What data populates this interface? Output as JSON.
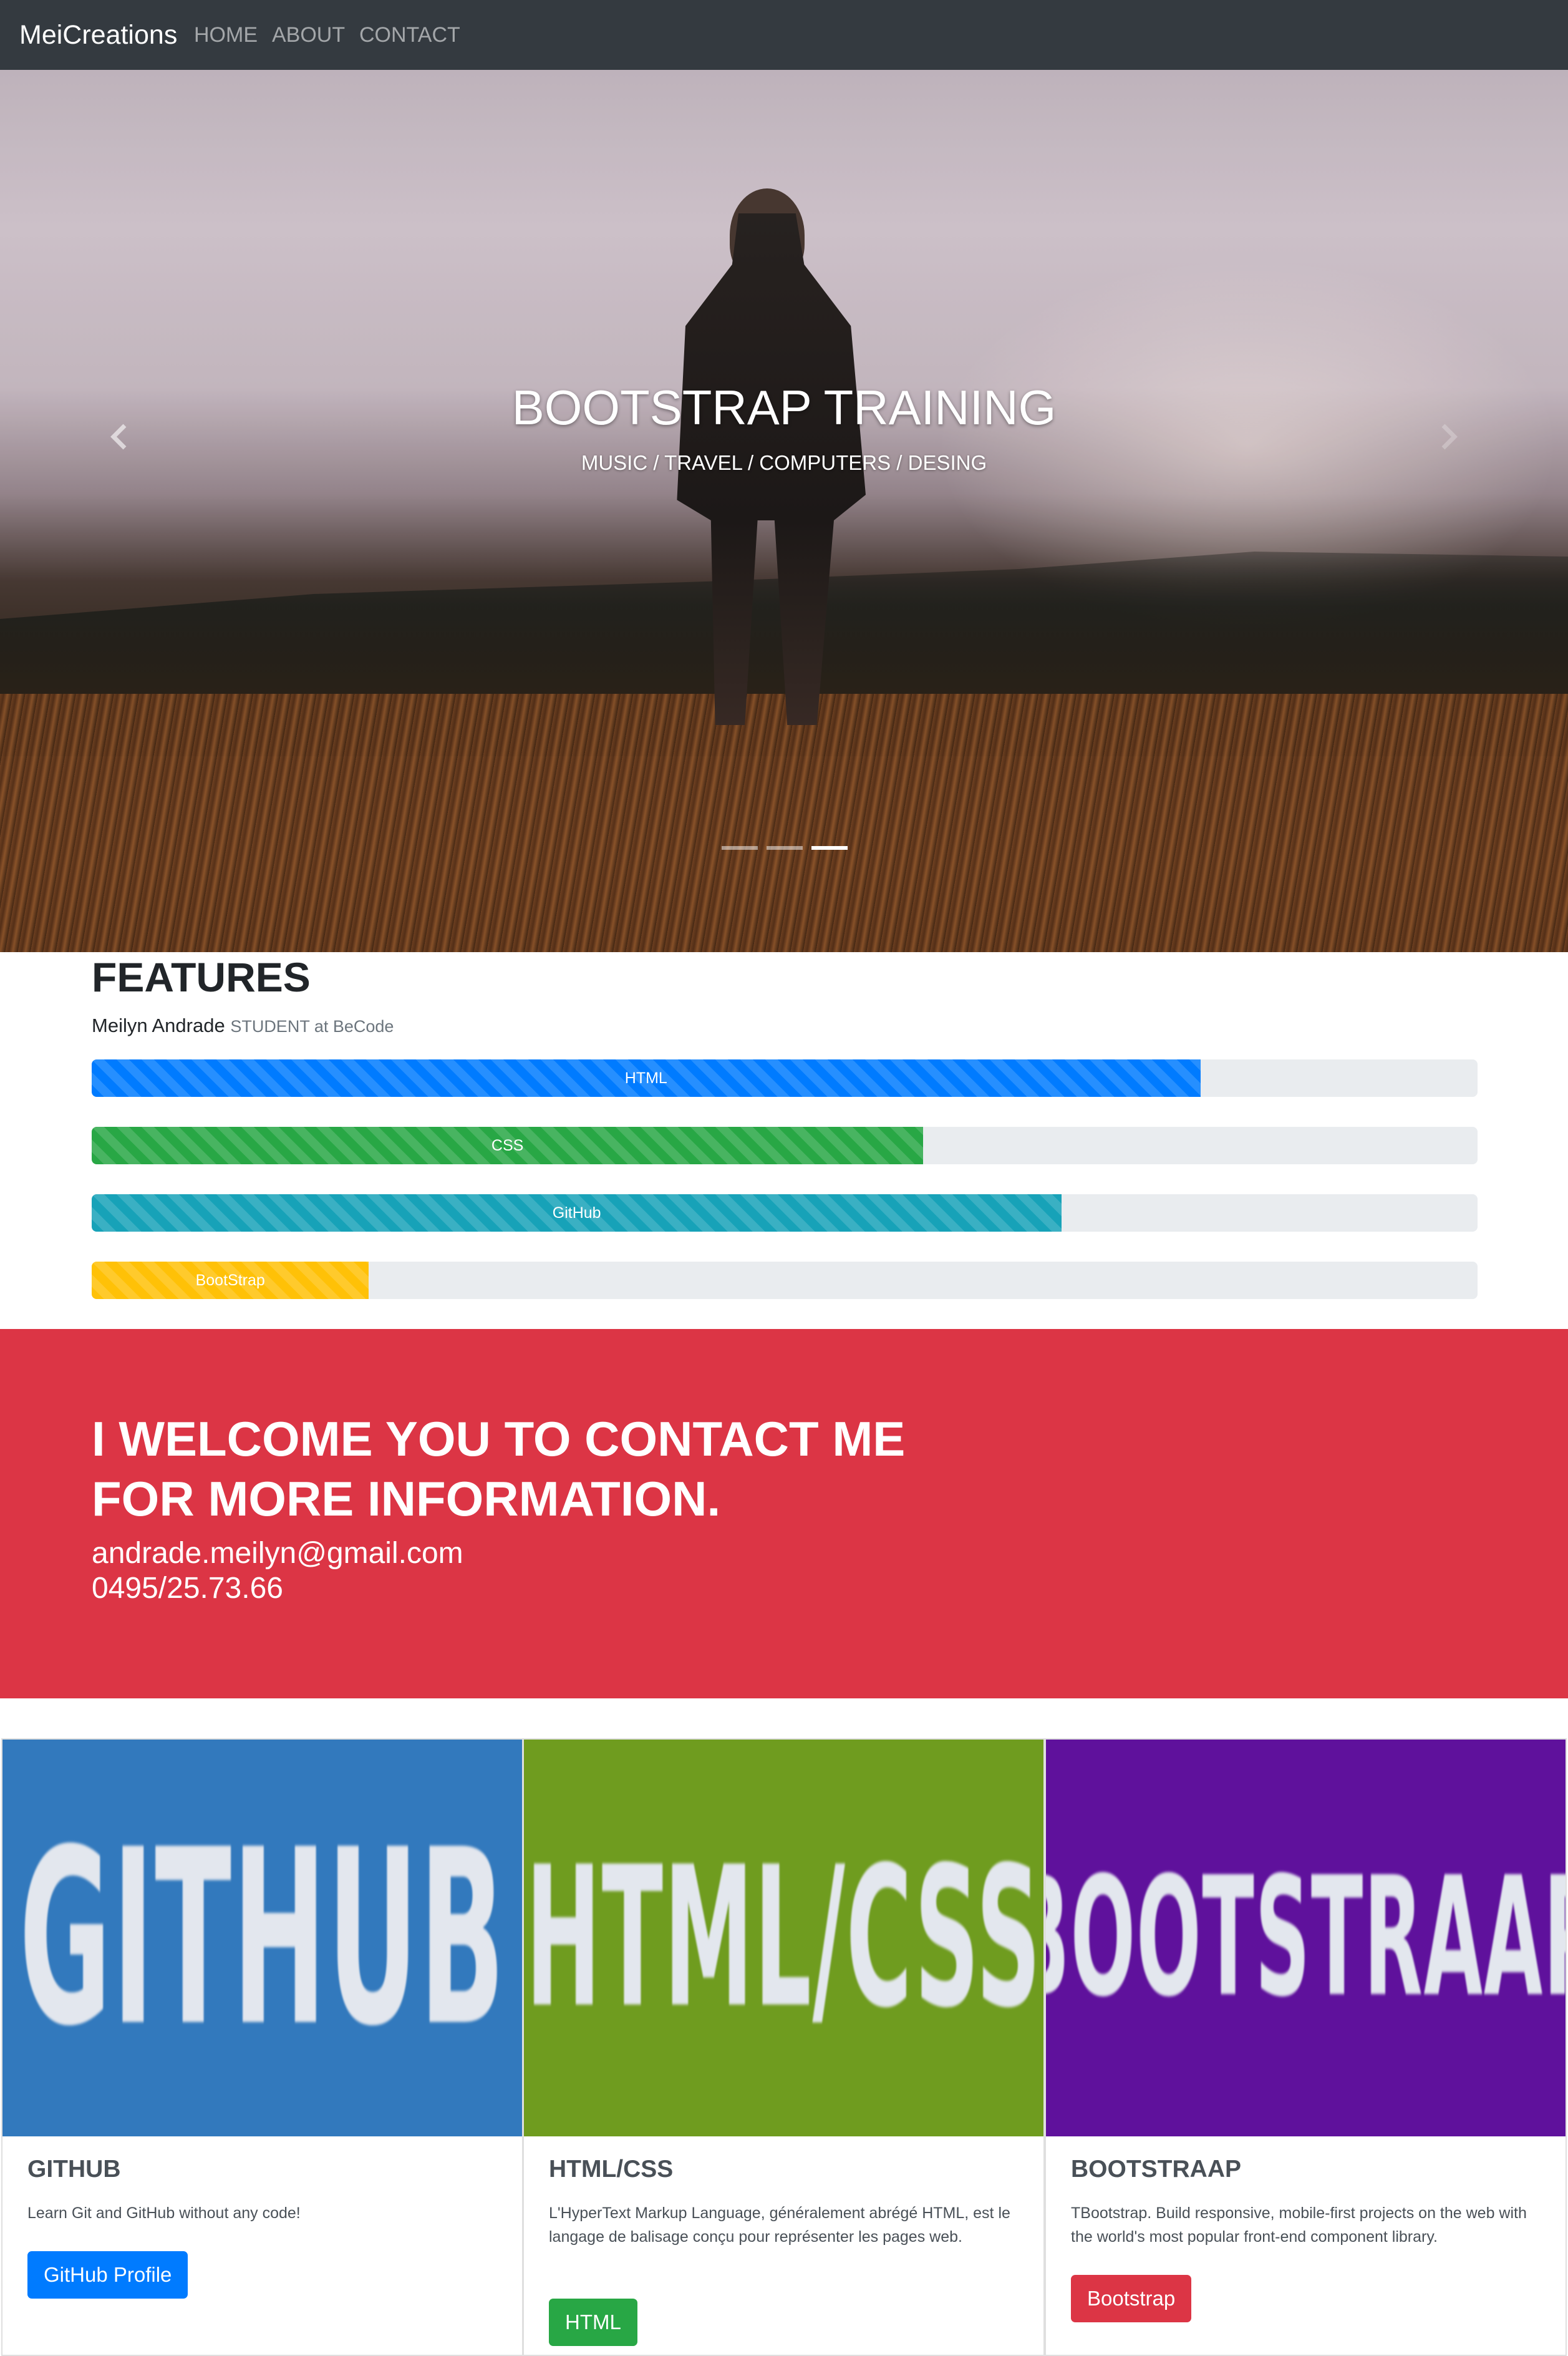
{
  "navbar": {
    "brand": "MeiCreations",
    "links": [
      "HOME",
      "ABOUT",
      "CONTACT"
    ]
  },
  "hero": {
    "title": "BOOTSTRAP TRAINING",
    "subtitle": "MUSIC / TRAVEL / COMPUTERS / DESING",
    "indicators": 3,
    "active_indicator": 3,
    "prev_icon": "chevron-left-icon",
    "next_icon": "chevron-right-icon"
  },
  "features": {
    "title": "FEATURES",
    "name": "Meilyn Andrade",
    "role": "STUDENT at BeCode",
    "skills": [
      {
        "label": "HTML",
        "percent": 80,
        "color": "#007bff"
      },
      {
        "label": "CSS",
        "percent": 60,
        "color": "#28a745"
      },
      {
        "label": "GitHub",
        "percent": 70,
        "color": "#17a2b8"
      },
      {
        "label": "BootStrap",
        "percent": 20,
        "color": "#ffc107"
      }
    ]
  },
  "contact": {
    "heading_line1": "I WELCOME YOU TO CONTACT ME",
    "heading_line2": "FOR MORE INFORMATION.",
    "email": "andrade.meilyn@gmail.com",
    "phone": "0495/25.73.66",
    "background": "#dc3545"
  },
  "cards": [
    {
      "image_text": "GITHUB",
      "title": "GITHUB",
      "text": "Learn Git and GitHub without any code!",
      "button": "GitHub Profile",
      "button_color": "#007bff",
      "image_color": "#3279bd"
    },
    {
      "image_text": "HTML/CSS",
      "title": "HTML/CSS",
      "text": "L'HyperText Markup Language, généralement abrégé HTML, est le langage de balisage conçu pour représenter les pages web.",
      "button": "HTML",
      "button_color": "#28a745",
      "image_color": "#6f9c1f"
    },
    {
      "image_text": "BOOTSTRAAP",
      "title": "BOOTSTRAAP",
      "text": "TBootstrap. Build responsive, mobile-first projects on the web with the world's most popular front-end component library.",
      "button": "Bootstrap",
      "button_color": "#dc3545",
      "image_color": "#5f119c"
    }
  ]
}
